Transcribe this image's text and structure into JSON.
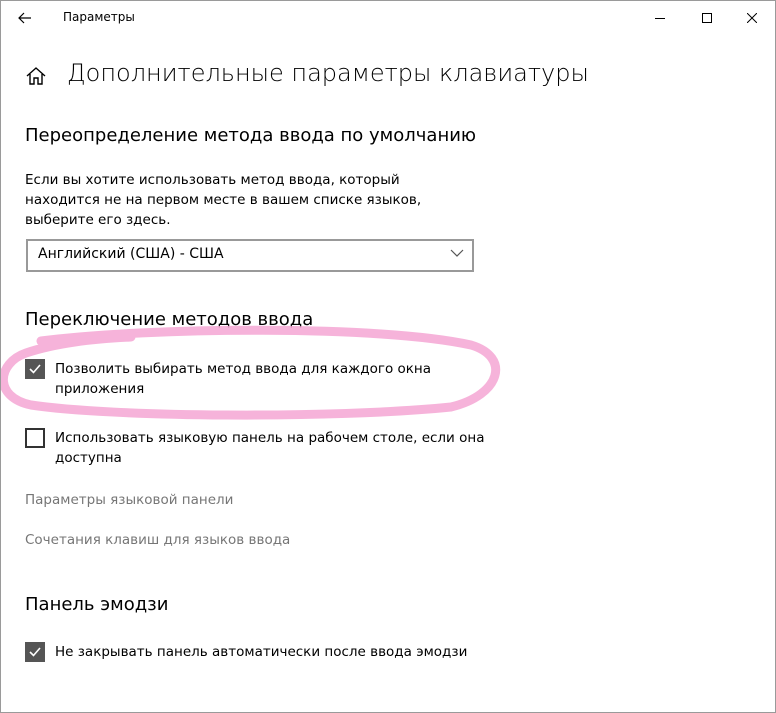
{
  "window": {
    "title": "Параметры",
    "back_icon": "arrow-left-icon",
    "controls": [
      "minimize-icon",
      "maximize-icon",
      "close-icon"
    ]
  },
  "page": {
    "home_icon": "home-icon",
    "title": "Дополнительные параметры клавиатуры"
  },
  "override_section": {
    "title": "Переопределение метода ввода по умолчанию",
    "description": "Если вы хотите использовать метод ввода, который находится не на первом месте в вашем списке языков, выберите его здесь.",
    "dropdown_value": "Английский (США) - США"
  },
  "switching_section": {
    "title": "Переключение методов ввода",
    "checkboxes": [
      {
        "label": "Позволить выбирать метод ввода для каждого окна приложения",
        "checked": true
      },
      {
        "label": "Использовать языковую панель на рабочем столе, если она доступна",
        "checked": false
      }
    ],
    "links": [
      "Параметры языковой панели",
      "Сочетания клавиш для языков ввода"
    ]
  },
  "emoji_section": {
    "title": "Панель эмодзи",
    "checkbox": {
      "label": "Не закрывать панель автоматически после ввода эмодзи",
      "checked": true
    }
  },
  "colors": {
    "highlight": "#f4a6d3",
    "checkbox_checked": "#555555",
    "link": "#767676"
  }
}
